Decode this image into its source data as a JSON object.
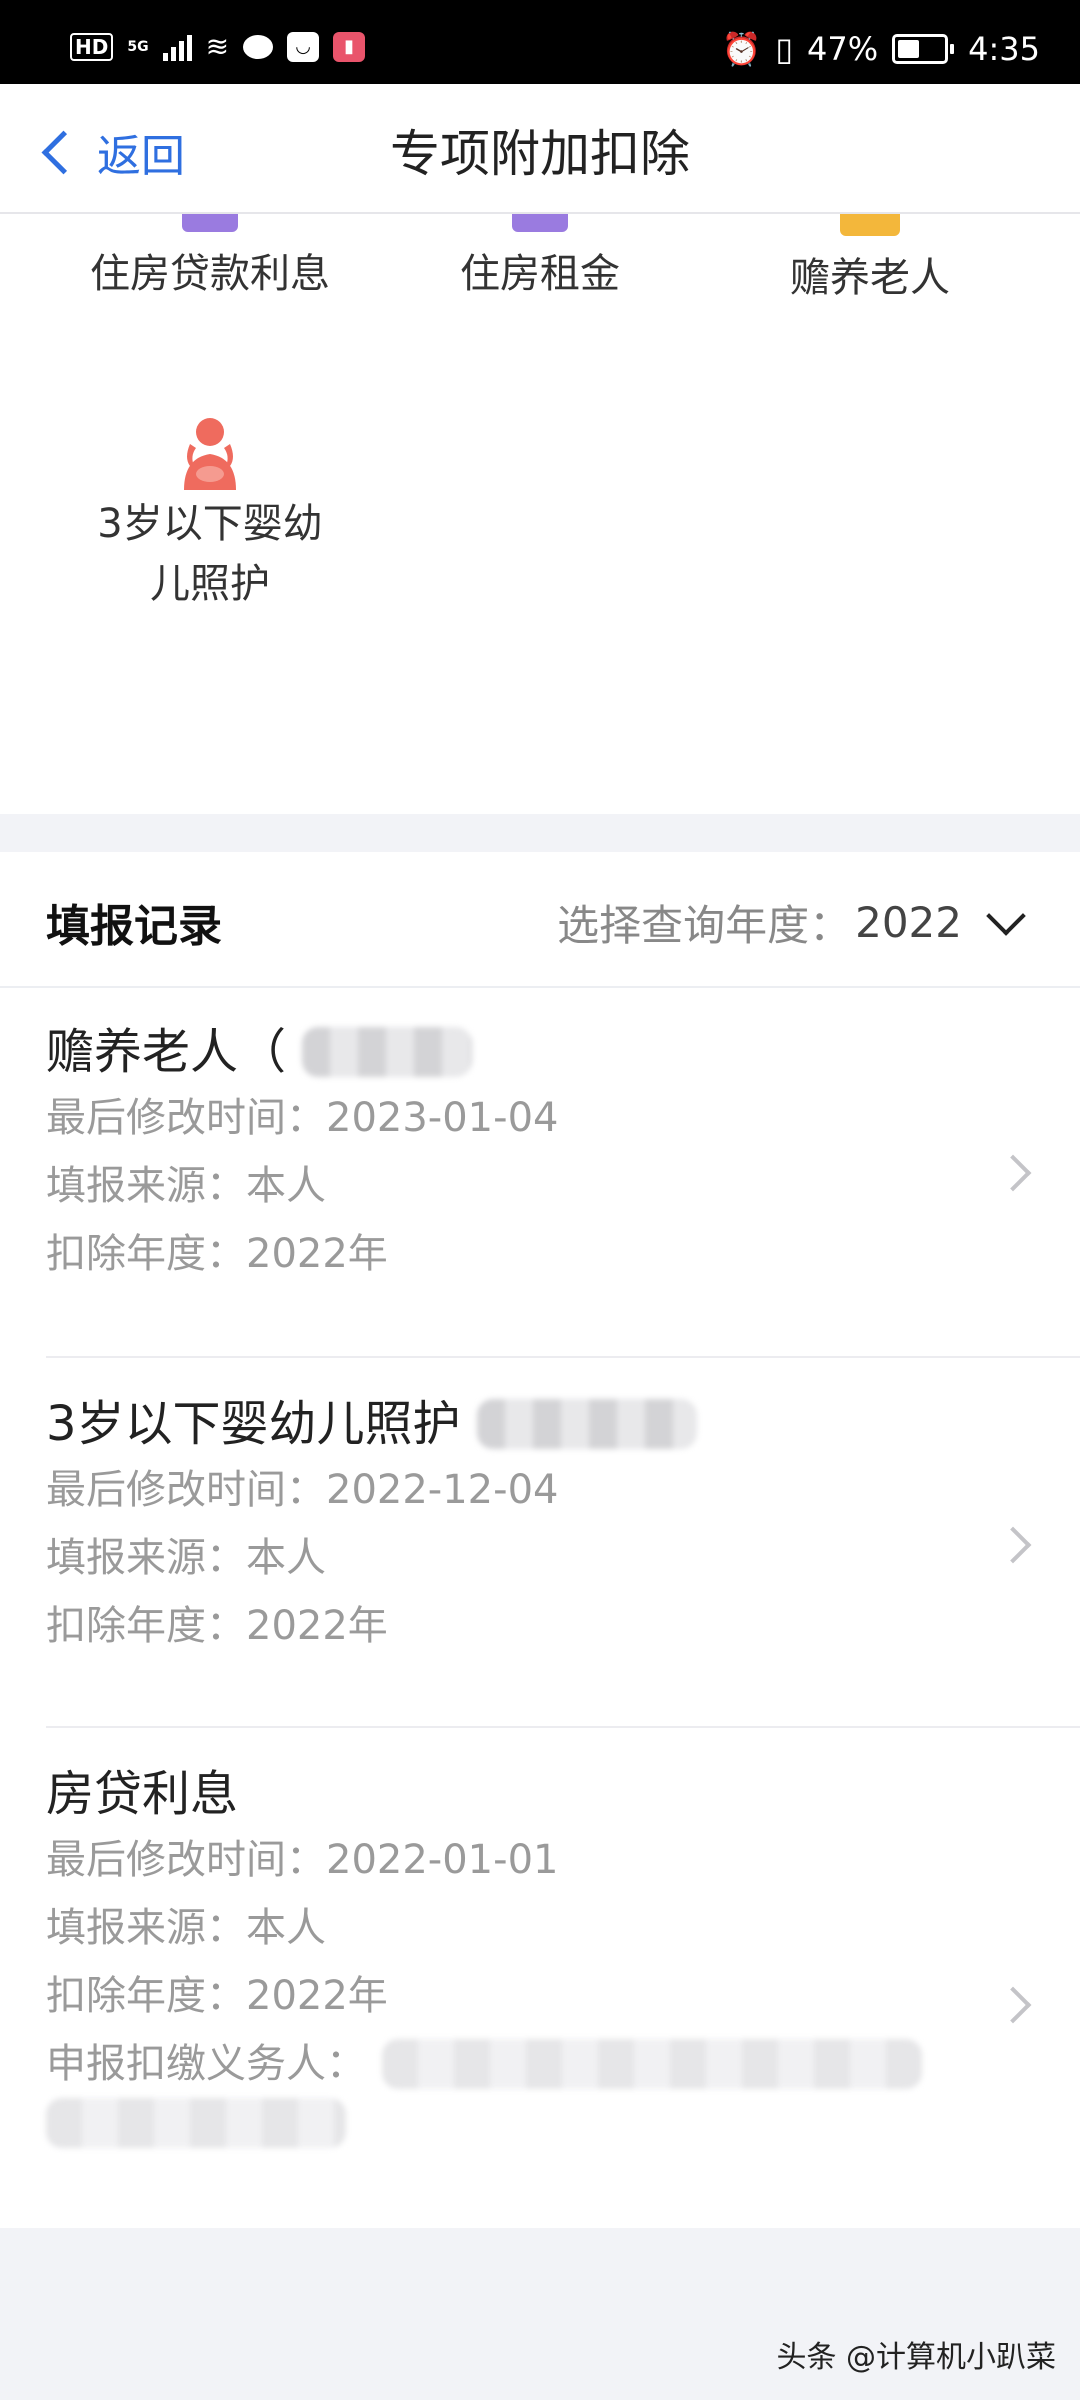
{
  "status_bar": {
    "hd": "HD",
    "network": "5G",
    "battery_percent": "47%",
    "battery_level": 0.47,
    "time": "4:35",
    "icons": [
      "signal-icon",
      "wifi-icon",
      "chat-icon",
      "app-icon",
      "app-red-icon",
      "alarm-icon",
      "vibrate-icon",
      "battery-icon"
    ]
  },
  "nav": {
    "back_label": "返回",
    "title": "专项附加扣除"
  },
  "categories": [
    {
      "label": "住房贷款利息",
      "icon": "house-loan-icon",
      "color": "#9a7be0"
    },
    {
      "label": "住房租金",
      "icon": "house-rent-icon",
      "color": "#9a7be0"
    },
    {
      "label": "赡养老人",
      "icon": "elderly-icon",
      "color": "#f3b73b"
    },
    {
      "label": "3岁以下婴幼儿照护",
      "icon": "infant-care-icon",
      "color": "#ef6b5e"
    }
  ],
  "records": {
    "title": "填报记录",
    "year_label": "选择查询年度：",
    "year_value": "2022",
    "items": [
      {
        "name": "赡养老人（",
        "modified_label": "最后修改时间：",
        "modified_value": "2023-01-04",
        "source_label": "填报来源：",
        "source_value": "本人",
        "year_label": "扣除年度：",
        "year_value": "2022年"
      },
      {
        "name": "3岁以下婴幼儿照护",
        "modified_label": "最后修改时间：",
        "modified_value": "2022-12-04",
        "source_label": "填报来源：",
        "source_value": "本人",
        "year_label": "扣除年度：",
        "year_value": "2022年"
      },
      {
        "name": "房贷利息",
        "modified_label": "最后修改时间：",
        "modified_value": "2022-01-01",
        "source_label": "填报来源：",
        "source_value": "本人",
        "year_label": "扣除年度：",
        "year_value": "2022年",
        "withholder_label": "申报扣缴义务人："
      }
    ]
  },
  "watermark": "头条 @计算机小趴菜"
}
